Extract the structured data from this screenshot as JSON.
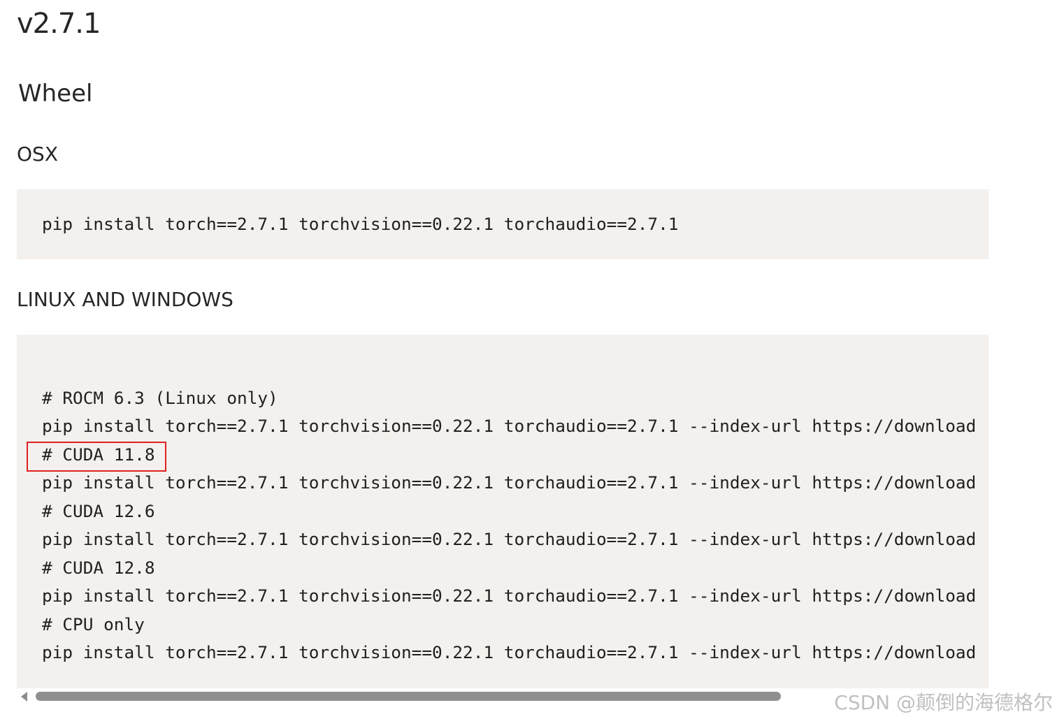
{
  "version_title": "v2.7.1",
  "sections": {
    "wheel_heading": "Wheel",
    "osx_heading": "OSX",
    "linux_windows_heading": "LINUX AND WINDOWS"
  },
  "osx_code": {
    "line": "pip install torch==2.7.1 torchvision==0.22.1 torchaudio==2.7.1"
  },
  "linux_code": {
    "lines": [
      "# ROCM 6.3 (Linux only)",
      "pip install torch==2.7.1 torchvision==0.22.1 torchaudio==2.7.1 --index-url https://download",
      "# CUDA 11.8",
      "pip install torch==2.7.1 torchvision==0.22.1 torchaudio==2.7.1 --index-url https://download",
      "# CUDA 12.6",
      "pip install torch==2.7.1 torchvision==0.22.1 torchaudio==2.7.1 --index-url https://download",
      "# CUDA 12.8",
      "pip install torch==2.7.1 torchvision==0.22.1 torchaudio==2.7.1 --index-url https://download",
      "# CPU only",
      "pip install torch==2.7.1 torchvision==0.22.1 torchaudio==2.7.1 --index-url https://download"
    ]
  },
  "icons": {
    "scroll_left": "chevron-left-icon"
  },
  "colors": {
    "code_background": "#f3f0ed",
    "highlight_border": "#e02020",
    "scrollbar_thumb": "#8f8f8f"
  },
  "watermark": "CSDN @颠倒的海德格尔"
}
